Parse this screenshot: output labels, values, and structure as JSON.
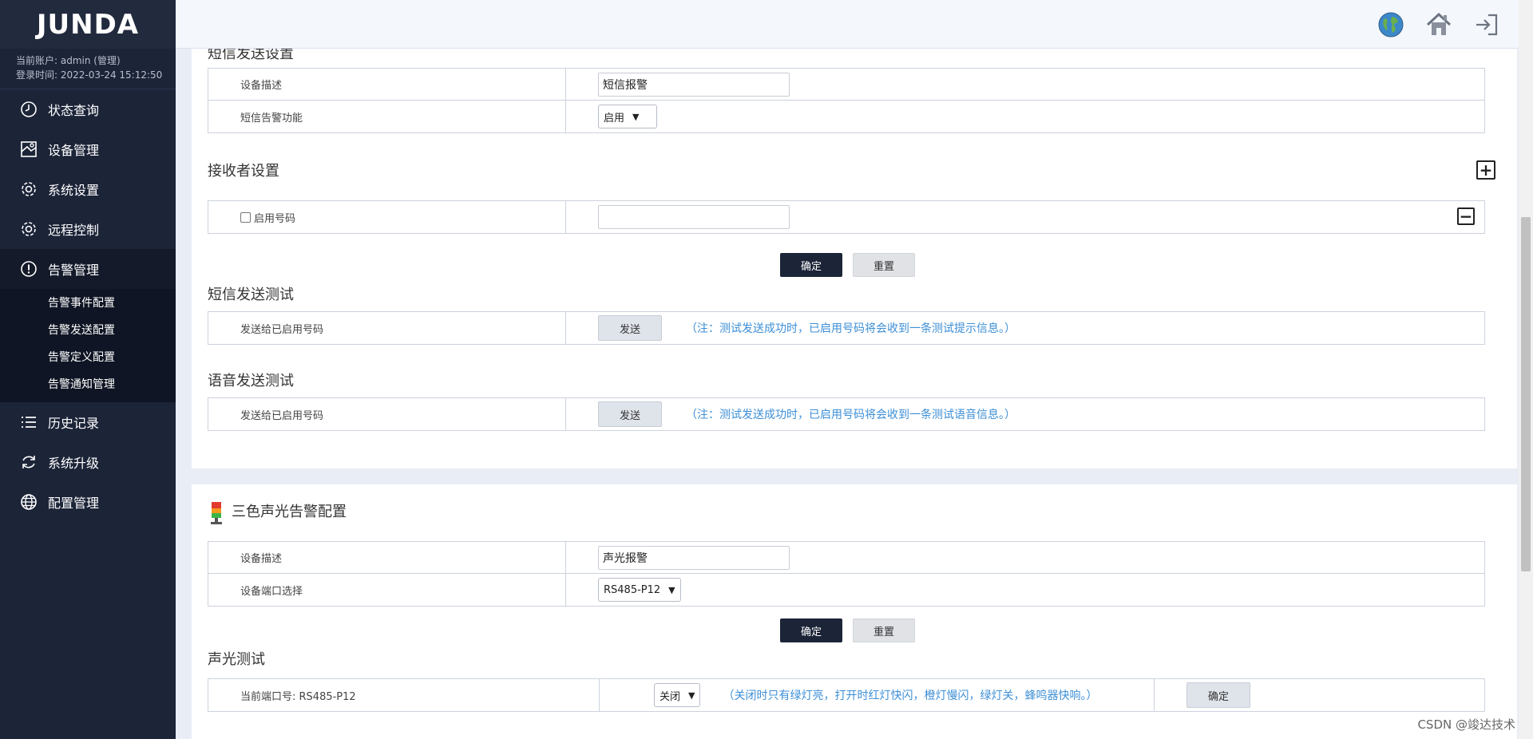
{
  "brand": {
    "logo_text": "JUNDA"
  },
  "account": {
    "user_line": "当前账户: admin (管理)",
    "login_line": "登录时间: 2022-03-24 15:12:50"
  },
  "nav": {
    "status": "状态查询",
    "device": "设备管理",
    "system": "系统设置",
    "remote": "远程控制",
    "alarm": "告警管理",
    "alarm_sub": [
      "告警事件配置",
      "告警发送配置",
      "告警定义配置",
      "告警通知管理"
    ],
    "history": "历史记录",
    "upgrade": "系统升级",
    "config": "配置管理"
  },
  "sms": {
    "section_title": "短信发送设置",
    "desc_label": "设备描述",
    "desc_value": "短信报警",
    "func_label": "短信告警功能",
    "func_value": "启用",
    "receiver_title": "接收者设置",
    "enable_label": "启用号码",
    "number_value": "",
    "confirm": "确定",
    "reset": "重置",
    "test_title": "短信发送测试",
    "test_label": "发送给已启用号码",
    "test_button": "发送",
    "test_note": "（注：测试发送成功时，已启用号码将会收到一条测试提示信息。）"
  },
  "voice": {
    "test_title": "语音发送测试",
    "test_label": "发送给已启用号码",
    "test_button": "发送",
    "test_note": "（注：测试发送成功时，已启用号码将会收到一条测试语音信息。）"
  },
  "tricolor": {
    "section_title": "三色声光告警配置",
    "desc_label": "设备描述",
    "desc_value": "声光报警",
    "port_label": "设备端口选择",
    "port_value": "RS485-P12",
    "confirm": "确定",
    "reset": "重置",
    "test_title": "声光测试",
    "current_port": "当前端口号: RS485-P12",
    "state_value": "关闭",
    "note": "（关闭时只有绿灯亮，打开时红灯快闪，橙灯慢闪，绿灯关，蜂鸣器快响。）",
    "apply": "确定"
  },
  "watermark": "CSDN @竣达技术"
}
